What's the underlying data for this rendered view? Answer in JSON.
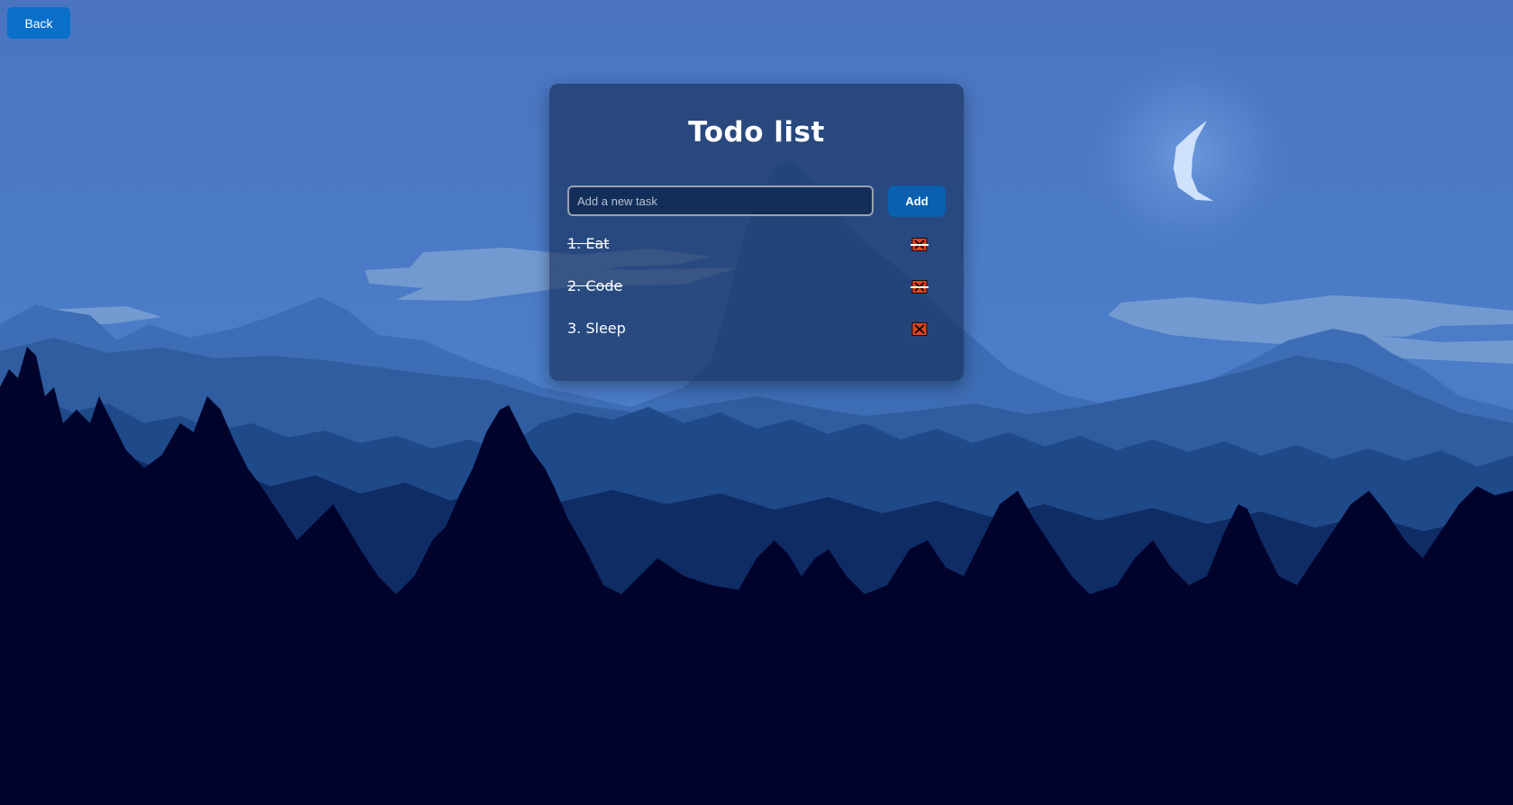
{
  "colors": {
    "accent": "#0a6fc9",
    "add_button": "#0a5fae",
    "delete_icon": "#e2461f"
  },
  "nav": {
    "back_label": "Back"
  },
  "todo": {
    "title": "Todo list",
    "input": {
      "placeholder": "Add a new task",
      "value": ""
    },
    "add_label": "Add",
    "tasks": [
      {
        "label": "1. Eat",
        "completed": true
      },
      {
        "label": "2. Code",
        "completed": true
      },
      {
        "label": "3. Sleep",
        "completed": false
      }
    ],
    "delete_icon": "close-icon"
  }
}
